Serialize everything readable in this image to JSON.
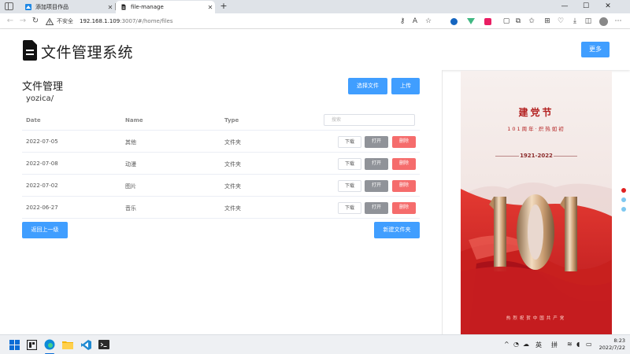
{
  "browser": {
    "tabs": [
      {
        "title": "添加项目作品",
        "active": false
      },
      {
        "title": "file-manage",
        "active": true
      }
    ],
    "address": {
      "security_label": "不安全",
      "host": "192.168.1.109",
      "path": ":3007/#/home/files"
    },
    "window_controls": {
      "minimize": "—",
      "maximize": "☐",
      "close": "✕"
    }
  },
  "header": {
    "title": "文件管理系统",
    "more_button": "更多"
  },
  "main": {
    "section_title": "文件管理",
    "current_path": "yozica/",
    "select_file_button": "选择文件",
    "upload_button": "上传",
    "back_button": "返回上一级",
    "new_folder_button": "新建文件夹",
    "table": {
      "headers": {
        "date": "Date",
        "name": "Name",
        "type": "Type"
      },
      "search_placeholder": "搜索",
      "actions": {
        "download": "下载",
        "open": "打开",
        "delete": "删除"
      },
      "rows": [
        {
          "date": "2022-07-05",
          "name": "其他",
          "type": "文件夹"
        },
        {
          "date": "2022-07-08",
          "name": "动漫",
          "type": "文件夹"
        },
        {
          "date": "2022-07-02",
          "name": "图片",
          "type": "文件夹"
        },
        {
          "date": "2022-06-27",
          "name": "音乐",
          "type": "文件夹"
        }
      ]
    }
  },
  "poster": {
    "title": "建党节",
    "subtitle": "101周年·炽热如初",
    "years": "1921-2022",
    "big_number": "101",
    "bottom_text": "热烈祝贺中国共产党"
  },
  "taskbar": {
    "tray_lang": "英",
    "tray_ime": "拼",
    "time": "8:23",
    "date": "2022/7/22"
  },
  "colors": {
    "primary": "#409eff",
    "info": "#909399",
    "danger": "#f56c6c",
    "poster_red": "#c8201e"
  }
}
